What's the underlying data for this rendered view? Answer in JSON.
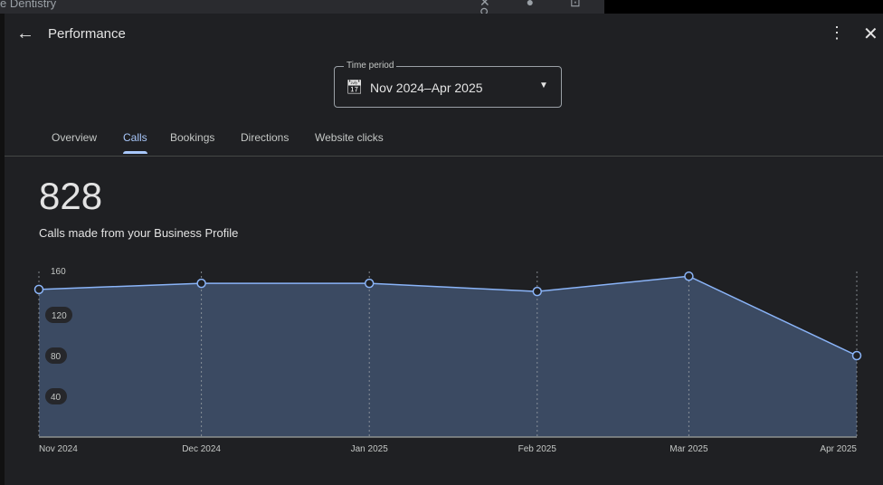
{
  "background": {
    "search_text": "e Dentistry"
  },
  "header": {
    "title": "Performance"
  },
  "time_period": {
    "label": "Time period",
    "value": "Nov 2024–Apr 2025"
  },
  "tabs": [
    {
      "label": "Overview"
    },
    {
      "label": "Calls",
      "active": true
    },
    {
      "label": "Bookings"
    },
    {
      "label": "Directions"
    },
    {
      "label": "Website clicks"
    }
  ],
  "summary": {
    "total": "828",
    "caption": "Calls made from your Business Profile"
  },
  "chart_data": {
    "type": "area",
    "categories": [
      "Nov 2024",
      "Dec 2024",
      "Jan 2025",
      "Feb 2025",
      "Mar 2025",
      "Apr 2025"
    ],
    "day_offsets": [
      0,
      30,
      61,
      92,
      120,
      151
    ],
    "values": [
      145,
      151,
      151,
      143,
      158,
      80
    ],
    "y_ticks": [
      "160",
      "120",
      "80",
      "40"
    ],
    "y_tick_values": [
      160,
      120,
      80,
      40
    ],
    "ylim": [
      0,
      160
    ],
    "colors": {
      "line": "#8ab4f8",
      "fill": "#3b4a62"
    }
  }
}
